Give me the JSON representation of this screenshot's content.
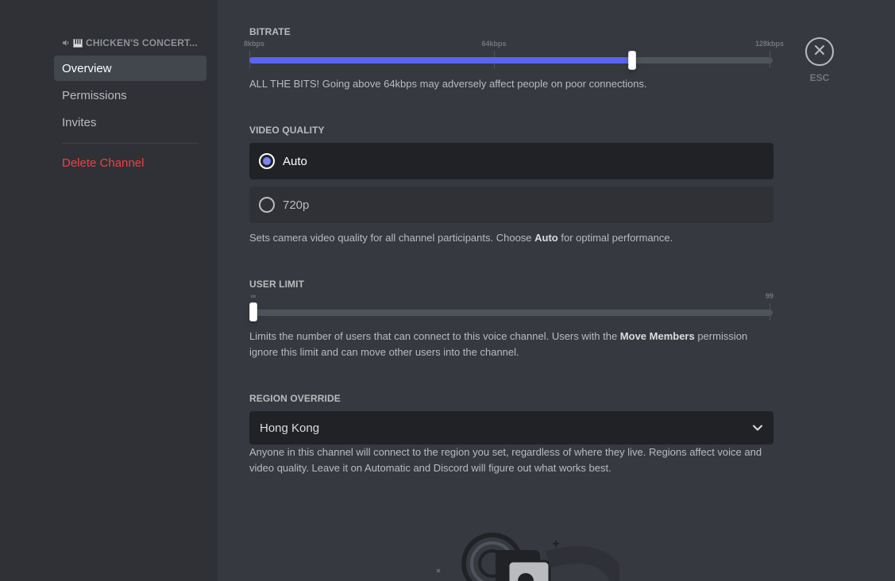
{
  "sidebar": {
    "channel_name": "CHICKEN'S CONCERT...",
    "items": [
      {
        "label": "Overview",
        "selected": true
      },
      {
        "label": "Permissions"
      },
      {
        "label": "Invites"
      }
    ],
    "delete_label": "Delete Channel"
  },
  "bitrate": {
    "title": "BITRATE",
    "ticks": [
      "8kbps",
      "64kbps",
      "128kbps"
    ],
    "value_kbps": 96,
    "help": "ALL THE BITS! Going above 64kbps may adversely affect people on poor connections."
  },
  "video_quality": {
    "title": "VIDEO QUALITY",
    "options": [
      {
        "label": "Auto",
        "selected": true
      },
      {
        "label": "720p",
        "selected": false
      }
    ],
    "help_prefix": "Sets camera video quality for all channel participants. Choose ",
    "help_bold": "Auto",
    "help_suffix": " for optimal performance."
  },
  "user_limit": {
    "title": "USER LIMIT",
    "ticks": [
      "∞",
      "99"
    ],
    "value": 0,
    "help_prefix": "Limits the number of users that can connect to this voice channel. Users with the ",
    "help_bold": "Move Members",
    "help_suffix": " permission ignore this limit and can move other users into the channel."
  },
  "region": {
    "title": "REGION OVERRIDE",
    "selected": "Hong Kong",
    "help": "Anyone in this channel will connect to the region you set, regardless of where they live. Regions affect voice and video quality. Leave it on Automatic and Discord will figure out what works best."
  },
  "close": {
    "label": "ESC"
  },
  "colors": {
    "accent": "#5865f2",
    "danger": "#ed4245",
    "sidebar_bg": "#2f3136",
    "content_bg": "#36393f"
  },
  "icons": [
    "speaker-icon",
    "piano-icon",
    "close-icon",
    "chevron-down-icon",
    "gear-illustration"
  ]
}
